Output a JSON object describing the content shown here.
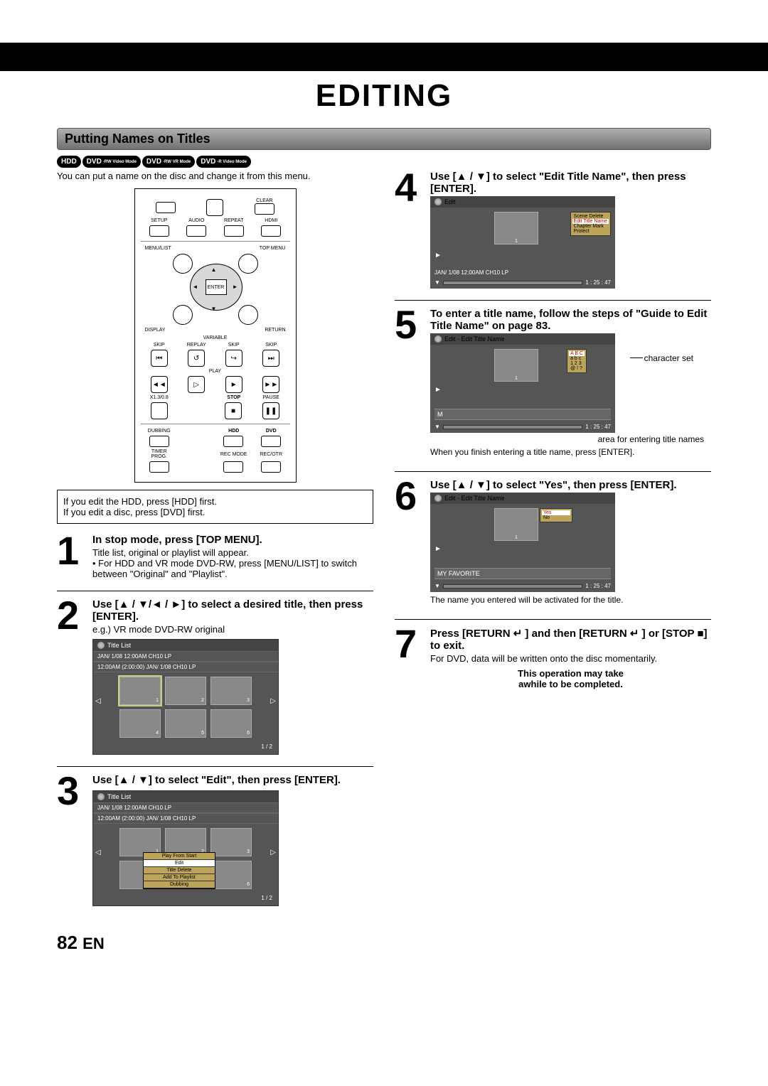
{
  "page": {
    "title": "EDITING",
    "section": "Putting Names on Titles",
    "intro": "You can put a name on the disc and change it from this menu.",
    "page_number": "82",
    "lang": "EN"
  },
  "badges": {
    "hdd": "HDD",
    "dvd1_top": "DVD",
    "dvd1_sub": "-RW Video Mode",
    "dvd2_top": "DVD",
    "dvd2_sub": "-RW VR Mode",
    "dvd3_top": "DVD",
    "dvd3_sub": "-R Video Mode"
  },
  "remote": {
    "clear": "CLEAR",
    "setup": "SETUP",
    "audio": "AUDIO",
    "repeat": "REPEAT",
    "hdmi": "HDMI",
    "menu_list": "MENU/LIST",
    "top_menu": "TOP MENU",
    "enter": "ENTER",
    "display": "DISPLAY",
    "return": "RETURN",
    "variable": "VARIABLE",
    "skip": "SKIP",
    "replay": "REPLAY",
    "play": "PLAY",
    "x13": "X1.3/0.8",
    "stop": "STOP",
    "pause": "PAUSE",
    "dubbing": "DUBBING",
    "hdd": "HDD",
    "dvd": "DVD",
    "timer": "TIMER PROG.",
    "recmode": "REC MODE",
    "recotr": "REC/OTR"
  },
  "note_box": {
    "line1": "If you edit the HDD, press [HDD] first.",
    "line2": "If you edit a disc, press [DVD] first."
  },
  "step1": {
    "num": "1",
    "title": "In stop mode, press [TOP MENU].",
    "body1": "Title list, original or playlist will appear.",
    "body2": "• For HDD and VR mode DVD-RW, press [MENU/LIST] to switch between \"Original\" and \"Playlist\"."
  },
  "step2": {
    "num": "2",
    "title": "Use [▲ / ▼/◄ / ►] to select a desired title, then press [ENTER].",
    "sub": "e.g.) VR mode DVD-RW original",
    "osd_title": "Title List",
    "osd_sub": "JAN/ 1/08 12:00AM  CH10  LP",
    "osd_sub2": "12:00AM (2:00:00)    JAN/ 1/08        CH10  LP",
    "thumb1": "1",
    "thumb2": "2",
    "thumb3": "3",
    "thumb4": "4",
    "thumb5": "5",
    "thumb6": "6",
    "footer": "1 / 2"
  },
  "step3": {
    "num": "3",
    "title": "Use [▲ / ▼] to select \"Edit\", then press [ENTER].",
    "osd_title": "Title List",
    "osd_sub": "JAN/ 1/08 12:00AM  CH10  LP",
    "osd_sub2": "12:00AM (2:00:00)    JAN/ 1/08        CH10  LP",
    "menu": {
      "m1": "Play From Start",
      "m2": "Edit",
      "m3": "Title Delete",
      "m4": "Add To Playlist",
      "m5": "Dubbing"
    },
    "footer": "1 / 2"
  },
  "step4": {
    "num": "4",
    "title": "Use [▲ / ▼] to select \"Edit Title Name\", then press [ENTER].",
    "osd_title": "Edit",
    "thumb": "1",
    "menu": {
      "m1": "Scene Delete",
      "m2": "Edit Title Name",
      "m3": "Chapter Mark",
      "m4": "Protect"
    },
    "status": "JAN/ 1/08 12:00AM CH10  LP",
    "time": "1 : 25 : 47"
  },
  "step5": {
    "num": "5",
    "title": "To enter a title name, follow the steps of \"Guide to Edit Title Name\" on page 83.",
    "osd_title": "Edit - Edit Title Name",
    "thumb": "1",
    "charset": {
      "r1": "A  B  C",
      "r2": "a  b  c",
      "r3": "1  2  3",
      "r4": "@  !  ?"
    },
    "entry": "M",
    "time": "1 : 25 : 47",
    "annot_charset": "character set",
    "annot_area": "area for entering title names",
    "after": "When you finish entering a title name, press [ENTER]."
  },
  "step6": {
    "num": "6",
    "title": "Use [▲ / ▼] to select \"Yes\", then press [ENTER].",
    "osd_title": "Edit - Edit Title Name",
    "thumb": "1",
    "menu": {
      "m1": "Yes",
      "m2": "No"
    },
    "entry": "MY FAVORITE",
    "time": "1 : 25 : 47",
    "after": "The name you entered will be activated for the title."
  },
  "step7": {
    "num": "7",
    "title": "Press [RETURN ↵ ] and then [RETURN ↵ ] or [STOP ■] to exit.",
    "body": "For DVD, data will be written onto the disc momentarily.",
    "warn1": "This operation may take",
    "warn2": "awhile to be completed."
  }
}
